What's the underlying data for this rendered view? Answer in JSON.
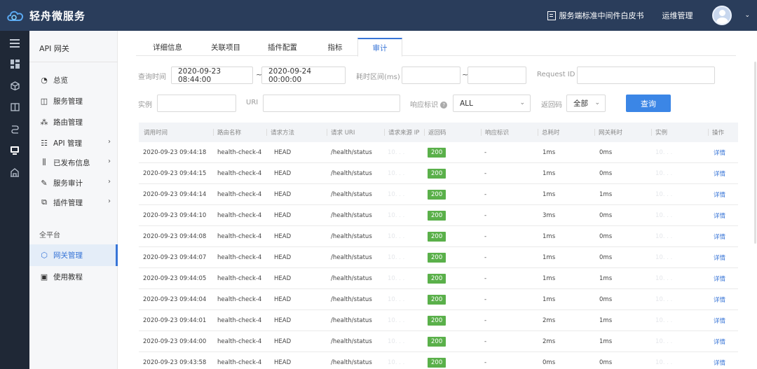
{
  "app": {
    "brand_name": "轻舟微服务"
  },
  "topbar": {
    "whitepaper_label": "服务端标准中间件白皮书",
    "ops_label": "运维管理",
    "caret": "⌄"
  },
  "rail": {
    "icons": [
      "menu-icon",
      "dashboard-icon",
      "cube-icon",
      "book-icon",
      "route-icon",
      "gateway-icon",
      "building-icon"
    ]
  },
  "menu": {
    "title": "API 网关",
    "items": [
      {
        "label": "总览",
        "icon": "gauge-icon",
        "chevron": false
      },
      {
        "label": "服务管理",
        "icon": "service-icon",
        "chevron": false
      },
      {
        "label": "路由管理",
        "icon": "route-icon",
        "chevron": false
      },
      {
        "label": "API 管理",
        "icon": "api-icon",
        "chevron": true
      },
      {
        "label": "已发布信息",
        "icon": "sliders-icon",
        "chevron": true
      },
      {
        "label": "服务审计",
        "icon": "audit-icon",
        "chevron": true
      },
      {
        "label": "插件管理",
        "icon": "plugin-icon",
        "chevron": true
      }
    ],
    "section_label": "全平台",
    "platform_items": [
      {
        "label": "网关管理",
        "icon": "hexagon-icon",
        "active": true
      },
      {
        "label": "使用教程",
        "icon": "save-icon",
        "active": false
      }
    ]
  },
  "tabs": [
    {
      "label": "详细信息",
      "active": false
    },
    {
      "label": "关联项目",
      "active": false
    },
    {
      "label": "插件配置",
      "active": false
    },
    {
      "label": "指标",
      "active": false
    },
    {
      "label": "审计",
      "active": true
    }
  ],
  "filters": {
    "query_time_label": "查询时间",
    "start_time": "2020-09-23 08:44:00",
    "end_time": "2020-09-24 00:00:00",
    "range_sep": "~",
    "duration_label": "耗时区间(ms)",
    "duration_min": "",
    "duration_max": "",
    "request_id_label": "Request ID",
    "request_id": "",
    "instance_label": "实例",
    "instance": "",
    "uri_label": "URI",
    "uri": "",
    "response_flag_label": "响应标识",
    "response_flag": "ALL",
    "return_code_label": "返回码",
    "return_code": "全部",
    "query_button": "查询"
  },
  "table": {
    "columns": [
      "调用时间",
      "路由名称",
      "请求方法",
      "请求 URI",
      "请求来源 IP",
      "返回码",
      "响应标识",
      "总耗时",
      "网关耗时",
      "实例",
      "操作"
    ],
    "rows": [
      {
        "time": "2020-09-23 09:44:18",
        "route": "health-check-4",
        "method": "HEAD",
        "uri": "/health/status",
        "ip": "10.  .  .  ",
        "code": "200",
        "flag": "-",
        "total": "1ms",
        "gateway": "0ms",
        "instance": "10.  .  .  ",
        "action": "详情"
      },
      {
        "time": "2020-09-23 09:44:15",
        "route": "health-check-4",
        "method": "HEAD",
        "uri": "/health/status",
        "ip": "10.  .  .  ",
        "code": "200",
        "flag": "-",
        "total": "1ms",
        "gateway": "0ms",
        "instance": "10.  .  .  ",
        "action": "详情"
      },
      {
        "time": "2020-09-23 09:44:14",
        "route": "health-check-4",
        "method": "HEAD",
        "uri": "/health/status",
        "ip": "10.  .  .  ",
        "code": "200",
        "flag": "-",
        "total": "1ms",
        "gateway": "1ms",
        "instance": "10.  .  .  ",
        "action": "详情"
      },
      {
        "time": "2020-09-23 09:44:10",
        "route": "health-check-4",
        "method": "HEAD",
        "uri": "/health/status",
        "ip": "10.  .  .  ",
        "code": "200",
        "flag": "-",
        "total": "3ms",
        "gateway": "0ms",
        "instance": "10.  .  .  ",
        "action": "详情"
      },
      {
        "time": "2020-09-23 09:44:08",
        "route": "health-check-4",
        "method": "HEAD",
        "uri": "/health/status",
        "ip": "10.  .  .  ",
        "code": "200",
        "flag": "-",
        "total": "1ms",
        "gateway": "0ms",
        "instance": "10.  .  .  ",
        "action": "详情"
      },
      {
        "time": "2020-09-23 09:44:07",
        "route": "health-check-4",
        "method": "HEAD",
        "uri": "/health/status",
        "ip": "10.  .  .  ",
        "code": "200",
        "flag": "-",
        "total": "1ms",
        "gateway": "0ms",
        "instance": "10.  .  .  ",
        "action": "详情"
      },
      {
        "time": "2020-09-23 09:44:05",
        "route": "health-check-4",
        "method": "HEAD",
        "uri": "/health/status",
        "ip": "10.  .  .  ",
        "code": "200",
        "flag": "-",
        "total": "1ms",
        "gateway": "1ms",
        "instance": "10.  .  .  ",
        "action": "详情"
      },
      {
        "time": "2020-09-23 09:44:04",
        "route": "health-check-4",
        "method": "HEAD",
        "uri": "/health/status",
        "ip": "10.  .  .  ",
        "code": "200",
        "flag": "-",
        "total": "1ms",
        "gateway": "0ms",
        "instance": "10.  .  .  ",
        "action": "详情"
      },
      {
        "time": "2020-09-23 09:44:01",
        "route": "health-check-4",
        "method": "HEAD",
        "uri": "/health/status",
        "ip": "10.  .  .  ",
        "code": "200",
        "flag": "-",
        "total": "2ms",
        "gateway": "1ms",
        "instance": "10.  .  .  ",
        "action": "详情"
      },
      {
        "time": "2020-09-23 09:44:00",
        "route": "health-check-4",
        "method": "HEAD",
        "uri": "/health/status",
        "ip": "10.  .  .  ",
        "code": "200",
        "flag": "-",
        "total": "2ms",
        "gateway": "1ms",
        "instance": "10.  .  .  ",
        "action": "详情"
      },
      {
        "time": "2020-09-23 09:43:58",
        "route": "health-check-4",
        "method": "HEAD",
        "uri": "/health/status",
        "ip": "10.  .  .  ",
        "code": "200",
        "flag": "-",
        "total": "0ms",
        "gateway": "0ms",
        "instance": "10.  .  .  ",
        "action": "详情"
      }
    ]
  }
}
